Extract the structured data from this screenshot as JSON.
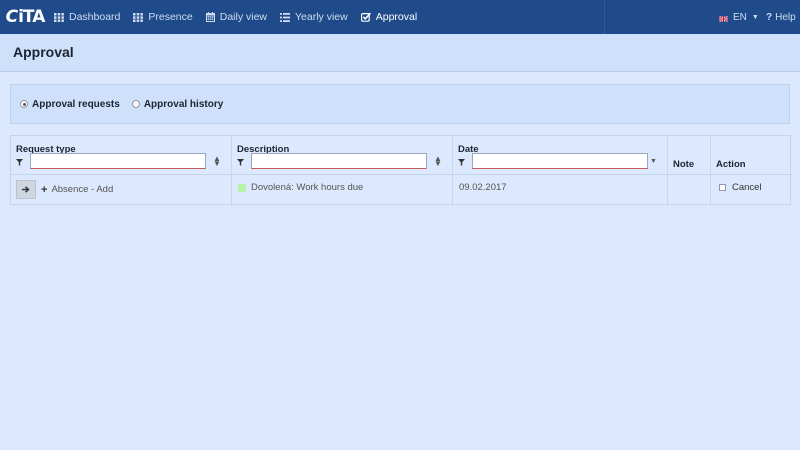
{
  "app": {
    "logo": "iTA"
  },
  "nav": {
    "items": [
      {
        "label": "Dashboard",
        "icon": "grid-icon"
      },
      {
        "label": "Presence",
        "icon": "grid-icon"
      },
      {
        "label": "Daily view",
        "icon": "calendar-icon"
      },
      {
        "label": "Yearly view",
        "icon": "list-icon"
      },
      {
        "label": "Approval",
        "icon": "check-square-icon",
        "active": true
      }
    ],
    "language": "EN",
    "help": "Help"
  },
  "page": {
    "title": "Approval"
  },
  "radios": {
    "requests": "Approval requests",
    "history": "Approval history",
    "selected": "requests"
  },
  "table": {
    "headers": {
      "request_type": "Request type",
      "description": "Description",
      "date": "Date",
      "note": "Note",
      "action": "Action"
    },
    "filters": {
      "request_type": "",
      "description": "",
      "date": ""
    },
    "rows": [
      {
        "request_type": "Absence - Add",
        "description": "Dovolená: Work hours due",
        "date": "09.02.2017",
        "note": "",
        "action": "Cancel",
        "action_checked": false
      }
    ]
  },
  "colors": {
    "navbar": "#1f4b8a",
    "background": "#dce8fd",
    "panel": "#cfe0fb",
    "status_green": "#b6f2a8"
  }
}
